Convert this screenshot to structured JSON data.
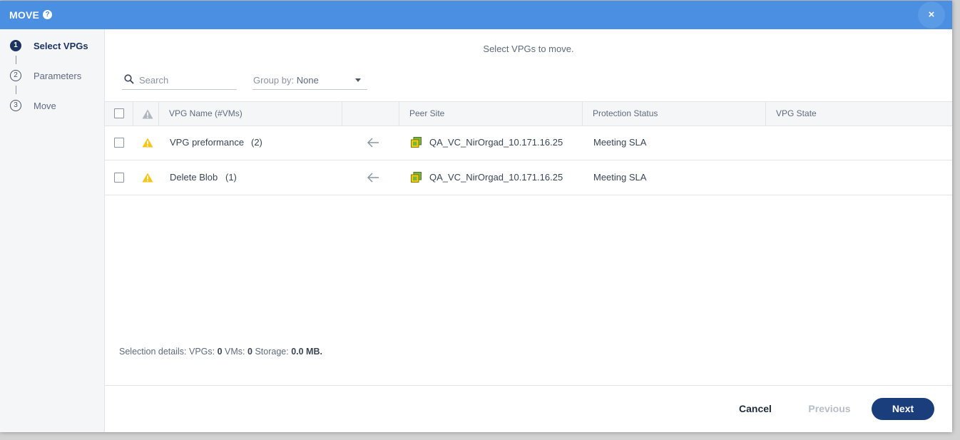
{
  "dialog": {
    "title": "MOVE",
    "help_icon": "question-circle-icon",
    "close_label": "×"
  },
  "steps": [
    {
      "number": "1",
      "label": "Select VPGs",
      "active": true
    },
    {
      "number": "2",
      "label": "Parameters",
      "active": false
    },
    {
      "number": "3",
      "label": "Move",
      "active": false
    }
  ],
  "main": {
    "caption": "Select VPGs to move.",
    "search": {
      "placeholder": "Search",
      "value": ""
    },
    "group_by": {
      "label": "Group by:",
      "value": "None"
    }
  },
  "table": {
    "columns": [
      "VPG Name (#VMs)",
      "Peer Site",
      "Protection Status",
      "VPG State"
    ],
    "rows": [
      {
        "name": "VPG preformance",
        "vms": "(2)",
        "peer_site": "QA_VC_NirOrgad_10.171.16.25",
        "protection_status": "Meeting SLA",
        "vpg_state": ""
      },
      {
        "name": "Delete Blob",
        "vms": "(1)",
        "peer_site": "QA_VC_NirOrgad_10.171.16.25",
        "protection_status": "Meeting SLA",
        "vpg_state": ""
      }
    ]
  },
  "selection": {
    "prefix": "Selection details:",
    "vpgs_label": "VPGs:",
    "vpgs": "0",
    "vms_label": "VMs:",
    "vms": "0",
    "storage_label": "Storage:",
    "storage": "0.0 MB."
  },
  "footer": {
    "cancel": "Cancel",
    "previous": "Previous",
    "next": "Next"
  },
  "colors": {
    "titlebar": "#4a8fe1",
    "primary_button": "#1a3d7c",
    "warning": "#f5c518",
    "site_icon_green": "#7cb342",
    "site_icon_yellow": "#f0d000"
  }
}
